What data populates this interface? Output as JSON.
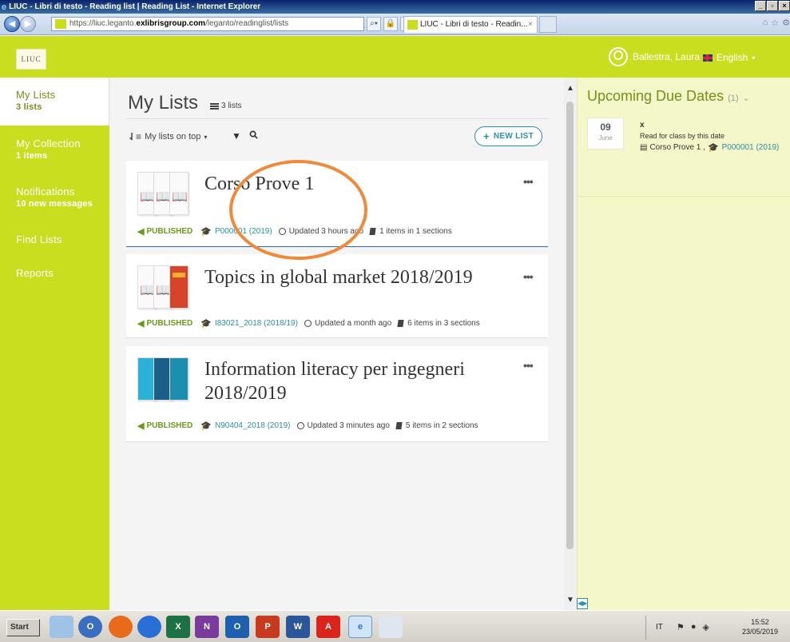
{
  "browser": {
    "window_title": "LIUC - Libri di testo - Reading list | Reading List - Internet Explorer",
    "url_prefix": "https://liuc.leganto.",
    "url_domain": "exlibrisgroup.com",
    "url_path": "/leganto/readinglist/lists",
    "tab_title": "LIUC - Libri di testo - Readin...",
    "tab_close": "×"
  },
  "header": {
    "logo_text": "LIUC",
    "user_name": "Ballestra, Laura",
    "language": "English"
  },
  "sidebar": {
    "items": [
      {
        "label": "My Lists",
        "sub": "3 lists"
      },
      {
        "label": "My Collection",
        "sub": "1 items"
      },
      {
        "label": "Notifications",
        "sub": "10 new messages"
      },
      {
        "label": "Find Lists",
        "sub": ""
      },
      {
        "label": "Reports",
        "sub": ""
      }
    ]
  },
  "main": {
    "title": "My Lists",
    "list_count": "3 lists",
    "sort_label": "My lists on top",
    "new_list_label": "NEW LIST",
    "cards": [
      {
        "title": "Corso Prove 1",
        "status": "PUBLISHED",
        "course": "P000001 (2019)",
        "updated": "Updated 3 hours ago",
        "items": "1 items in 1 sections"
      },
      {
        "title": "Topics in global market 2018/2019",
        "status": "PUBLISHED",
        "course": "I83021_2018 (2018/19)",
        "updated": "Updated a month ago",
        "items": "6 items in 3 sections"
      },
      {
        "title": "Information literacy per ingegneri 2018/2019",
        "status": "PUBLISHED",
        "course": "N90404_2018 (2019)",
        "updated": "Updated 3 minutes ago",
        "items": "5 items in 2 sections"
      }
    ]
  },
  "right_panel": {
    "title": "Upcoming Due Dates",
    "count": "(1)",
    "due": {
      "day": "09",
      "month": "June",
      "title": "x",
      "reason": "Read for class by this date",
      "course_name": "Corso Prove 1 ,",
      "course_code": "P000001 (2019)"
    }
  },
  "taskbar": {
    "start": "Start",
    "lang": "IT",
    "time": "15:52",
    "date": "23/05/2019"
  },
  "colors": {
    "brand": "#c8de1e",
    "accent": "#2b8fa8",
    "published": "#6a9a1a",
    "annotation": "#ef8a3a"
  }
}
